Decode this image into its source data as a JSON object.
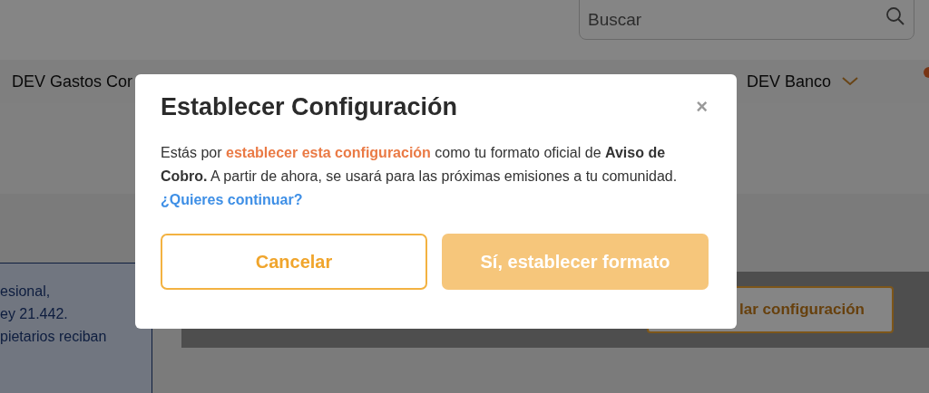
{
  "search": {
    "placeholder": "Buscar"
  },
  "nav": {
    "items": [
      {
        "label": "DEV Gastos Cor",
        "dropdown": false
      },
      {
        "label": "DEV Banco",
        "dropdown": true
      }
    ]
  },
  "info_box": {
    "lines": [
      "esional,",
      "ey 21.442.",
      "pietarios reciban"
    ]
  },
  "config_button": {
    "label": "lar configuración"
  },
  "modal": {
    "title": "Establecer Configuración",
    "close": "×",
    "message": [
      {
        "kind": "plain",
        "text": "Estás por "
      },
      {
        "kind": "highlight",
        "text": "establecer esta configuración"
      },
      {
        "kind": "plain",
        "text": " como tu formato oficial de "
      },
      {
        "kind": "bold",
        "text": "Aviso de Cobro."
      },
      {
        "kind": "plain",
        "text": " A partir de ahora, se usará para las próximas emisiones a tu comunidad. "
      },
      {
        "kind": "link",
        "text": "¿Quieres continuar?"
      }
    ],
    "buttons": [
      {
        "label": "Cancelar",
        "kind": "outline"
      },
      {
        "label": "Sí, establecer formato",
        "kind": "primary"
      }
    ]
  }
}
